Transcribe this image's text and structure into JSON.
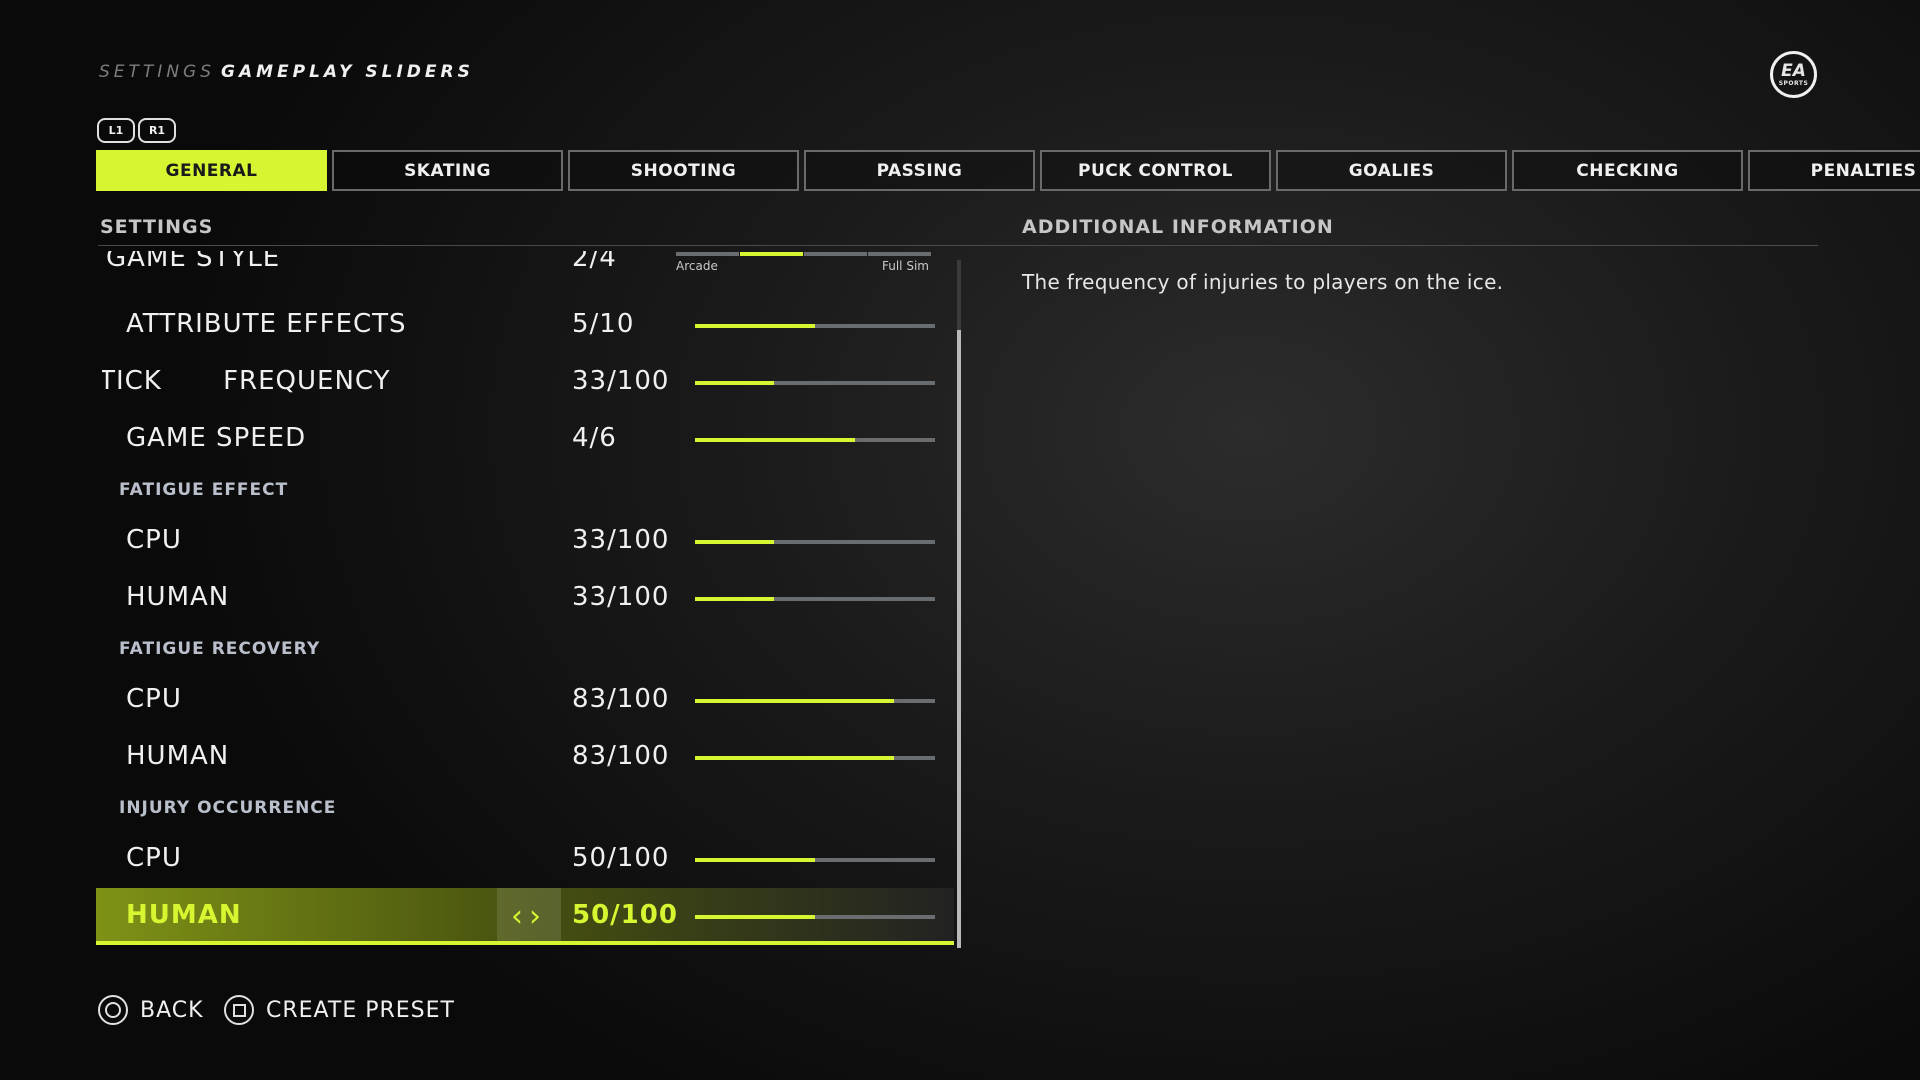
{
  "header": {
    "breadcrumb": "SETTINGS",
    "title": "GAMEPLAY SLIDERS"
  },
  "bumpers": {
    "left": "L1",
    "right": "R1"
  },
  "tabs": [
    {
      "label": "GENERAL",
      "active": true
    },
    {
      "label": "SKATING",
      "active": false
    },
    {
      "label": "SHOOTING",
      "active": false
    },
    {
      "label": "PASSING",
      "active": false
    },
    {
      "label": "PUCK CONTROL",
      "active": false
    },
    {
      "label": "GOALIES",
      "active": false
    },
    {
      "label": "CHECKING",
      "active": false
    },
    {
      "label": "PENALTIES",
      "active": false
    }
  ],
  "settings": {
    "heading": "SETTINGS",
    "game_style": {
      "label": "GAME STYLE",
      "value": "2/4",
      "step": 2,
      "steps": 4,
      "left_label": "Arcade",
      "right_label": "Full Sim"
    },
    "attribute_effects": {
      "label": "ATTRIBUTE EFFECTS",
      "value": "5/10",
      "fraction": 0.5
    },
    "broken_stick": {
      "label": "BROKEN STICK FREQUENCY",
      "value": "33/100",
      "fraction": 0.33
    },
    "game_speed": {
      "label": "GAME SPEED",
      "value": "4/6",
      "fraction": 0.667
    },
    "fatigue_effect": {
      "label": "FATIGUE EFFECT",
      "cpu": {
        "label": "CPU",
        "value": "33/100",
        "fraction": 0.33
      },
      "human": {
        "label": "HUMAN",
        "value": "33/100",
        "fraction": 0.33
      }
    },
    "fatigue_recovery": {
      "label": "FATIGUE RECOVERY",
      "cpu": {
        "label": "CPU",
        "value": "83/100",
        "fraction": 0.83
      },
      "human": {
        "label": "HUMAN",
        "value": "83/100",
        "fraction": 0.83
      }
    },
    "injury_occurrence": {
      "label": "INJURY OCCURRENCE",
      "cpu": {
        "label": "CPU",
        "value": "50/100",
        "fraction": 0.5
      },
      "human": {
        "label": "HUMAN",
        "value": "50/100",
        "fraction": 0.5,
        "selected": true
      }
    }
  },
  "additional_info": {
    "heading": "ADDITIONAL INFORMATION",
    "text": "The frequency of injuries to players on the ice."
  },
  "footer": {
    "back_label": "BACK",
    "create_preset_label": "CREATE PRESET"
  },
  "colors": {
    "accent": "#d7f531",
    "track": "#6a6d70"
  }
}
